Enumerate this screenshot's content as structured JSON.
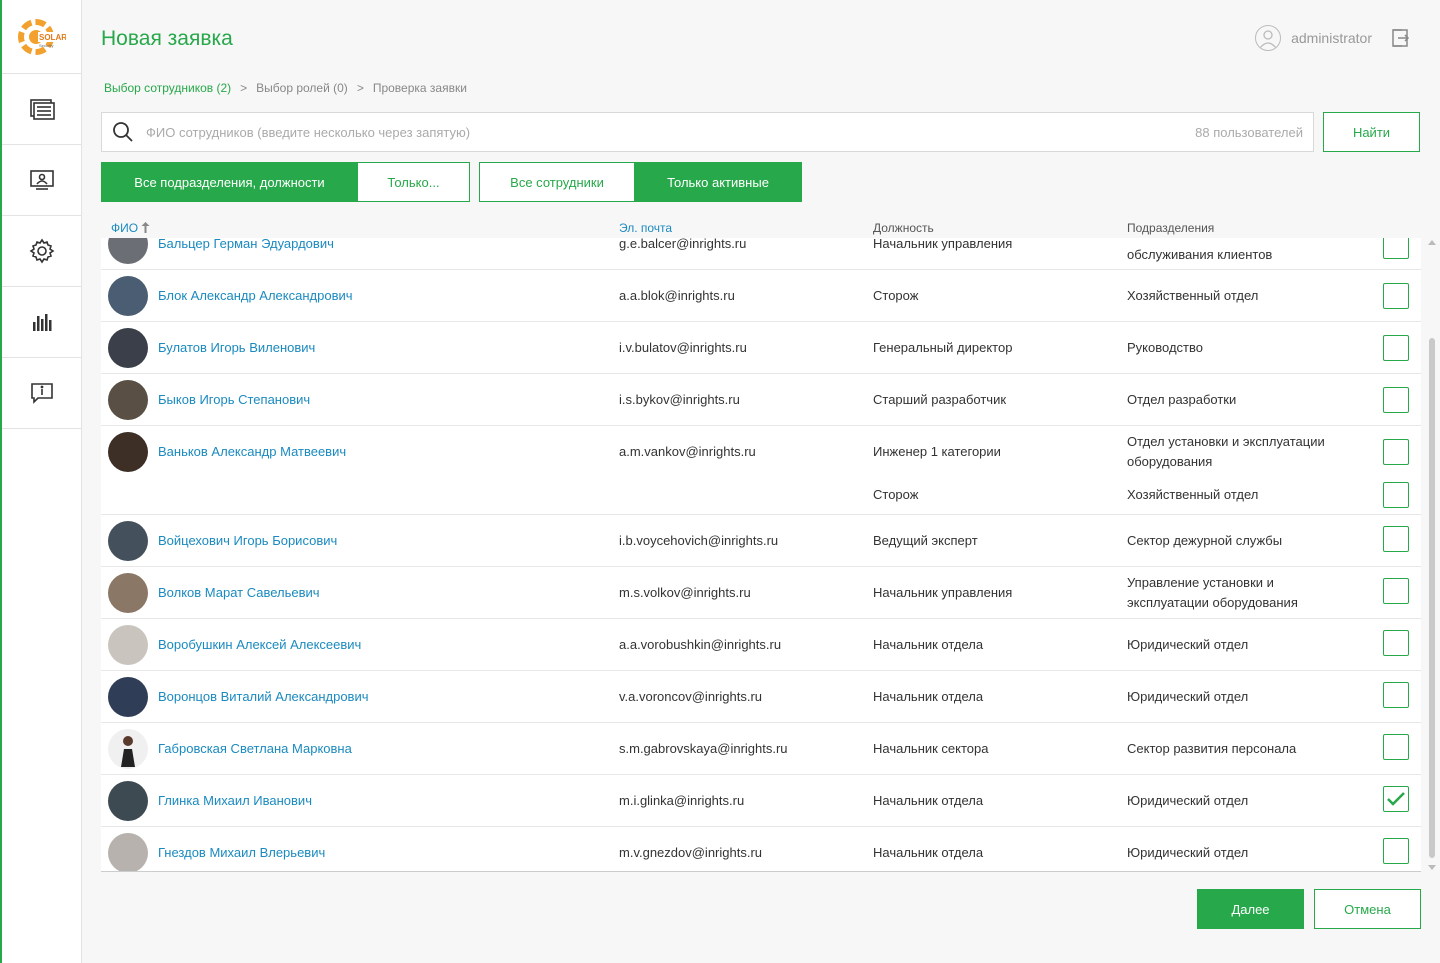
{
  "app": {
    "title": "Новая заявка",
    "user": "administrator",
    "accent": "#27a84a",
    "link": "#1a8abf"
  },
  "sidebar": {
    "items": [
      {
        "icon": "requests-icon"
      },
      {
        "icon": "monitor-user-icon"
      },
      {
        "icon": "gear-icon"
      },
      {
        "icon": "chart-icon"
      },
      {
        "icon": "info-message-icon"
      }
    ]
  },
  "breadcrumb": {
    "step1": "Выбор сотрудников (2)",
    "sep1": ">",
    "step2": "Выбор ролей (0)",
    "sep2": ">",
    "step3": "Проверка заявки"
  },
  "search": {
    "placeholder": "ФИО сотрудников (введите несколько через запятую)",
    "count": "88 пользователей",
    "find_label": "Найти"
  },
  "filters": {
    "all_depts": "Все подразделения, должности",
    "only": "Только...",
    "all_emps": "Все сотрудники",
    "only_active": "Только активные"
  },
  "table": {
    "col_name": "ФИО",
    "col_email": "Эл. почта",
    "col_position": "Должность",
    "col_dept": "Подразделения",
    "rows": [
      {
        "name": "Бальцер Герман Эдуардович",
        "email": "g.e.balcer@inrights.ru",
        "position": "Начальник управления",
        "dept": "обслуживания клиентов",
        "checked": false
      },
      {
        "name": "Блок Александр Александрович",
        "email": "a.a.blok@inrights.ru",
        "position": "Сторож",
        "dept": "Хозяйственный отдел",
        "checked": false
      },
      {
        "name": "Булатов Игорь Виленович",
        "email": "i.v.bulatov@inrights.ru",
        "position": "Генеральный директор",
        "dept": "Руководство",
        "checked": false
      },
      {
        "name": "Быков Игорь Степанович",
        "email": "i.s.bykov@inrights.ru",
        "position": "Старший разработчик",
        "dept": "Отдел разработки",
        "checked": false
      },
      {
        "name": "Ваньков Александр Матвеевич",
        "email": "a.m.vankov@inrights.ru",
        "position": "Инженер 1 категории",
        "dept": "Отдел установки и эксплуатации оборудования",
        "position2": "Сторож",
        "dept2": "Хозяйственный отдел",
        "checked": false
      },
      {
        "name": "Войцехович Игорь Борисович",
        "email": "i.b.voycehovich@inrights.ru",
        "position": "Ведущий эксперт",
        "dept": "Сектор дежурной службы",
        "checked": false
      },
      {
        "name": "Волков Марат Савельевич",
        "email": "m.s.volkov@inrights.ru",
        "position": "Начальник управления",
        "dept": "Управление установки и эксплуатации оборудования",
        "checked": false
      },
      {
        "name": "Воробушкин Алексей Алексеевич",
        "email": "a.a.vorobushkin@inrights.ru",
        "position": "Начальник отдела",
        "dept": "Юридический отдел",
        "checked": false
      },
      {
        "name": "Воронцов Виталий Александрович",
        "email": "v.a.voroncov@inrights.ru",
        "position": "Начальник отдела",
        "dept": "Юридический отдел",
        "checked": false
      },
      {
        "name": "Габровская Светлана Марковна",
        "email": "s.m.gabrovskaya@inrights.ru",
        "position": "Начальник сектора",
        "dept": "Сектор развития персонала",
        "checked": false
      },
      {
        "name": "Глинка Михаил Иванович",
        "email": "m.i.glinka@inrights.ru",
        "position": "Начальник отдела",
        "dept": "Юридический отдел",
        "checked": true
      },
      {
        "name": "Гнездов Михаил Влерьевич",
        "email": "m.v.gnezdov@inrights.ru",
        "position": "Начальник отдела",
        "dept": "Юридический отдел",
        "checked": false
      }
    ]
  },
  "footer": {
    "next": "Далее",
    "cancel": "Отмена"
  }
}
